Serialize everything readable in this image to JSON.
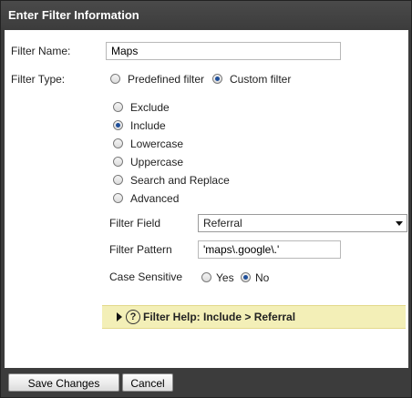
{
  "dialog": {
    "title": "Enter Filter Information"
  },
  "filter_name": {
    "label": "Filter Name:",
    "value": "Maps"
  },
  "filter_type": {
    "label": "Filter Type:",
    "options": [
      {
        "label": "Predefined filter",
        "checked": false
      },
      {
        "label": "Custom filter",
        "checked": true
      }
    ]
  },
  "custom_options": [
    {
      "label": "Exclude",
      "checked": false
    },
    {
      "label": "Include",
      "checked": true
    },
    {
      "label": "Lowercase",
      "checked": false
    },
    {
      "label": "Uppercase",
      "checked": false
    },
    {
      "label": "Search and Replace",
      "checked": false
    },
    {
      "label": "Advanced",
      "checked": false
    }
  ],
  "filter_field": {
    "label": "Filter Field",
    "value": "Referral"
  },
  "filter_pattern": {
    "label": "Filter Pattern",
    "value": "'maps\\.google\\.'"
  },
  "case_sensitive": {
    "label": "Case Sensitive",
    "options": [
      {
        "label": "Yes",
        "checked": false
      },
      {
        "label": "No",
        "checked": true
      }
    ]
  },
  "help": {
    "label": "Filter Help: Include  >  Referral",
    "icon": "question-circle-icon"
  },
  "footer": {
    "save_label": "Save Changes",
    "cancel_label": "Cancel"
  }
}
